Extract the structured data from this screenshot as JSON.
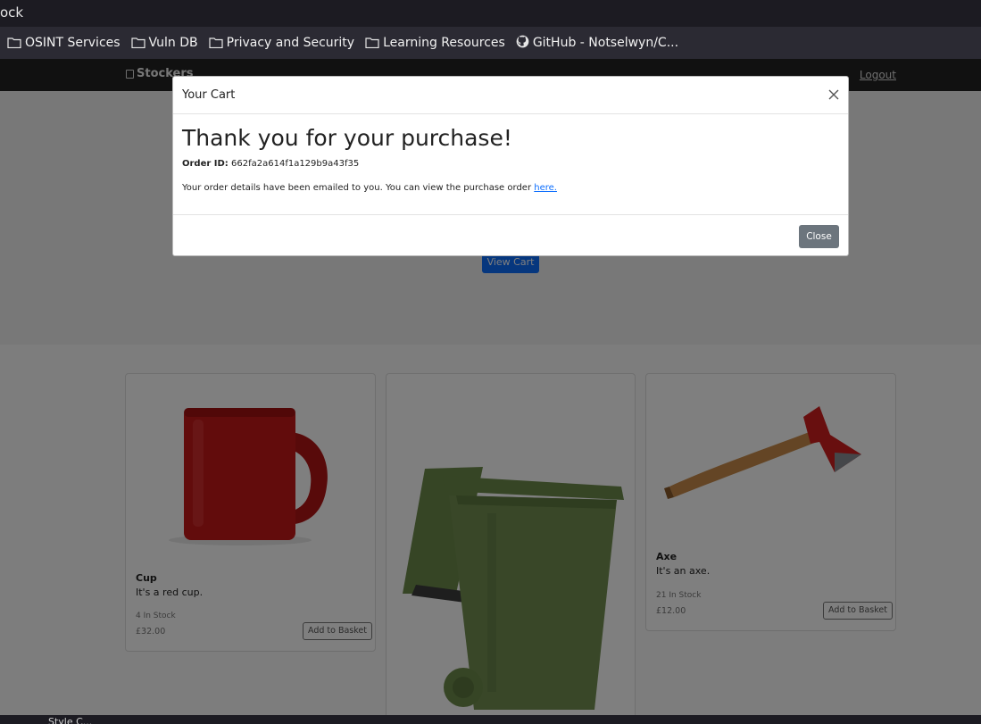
{
  "browser": {
    "title_fragment": "ock",
    "bookmarks": [
      {
        "label": "OSINT Services",
        "icon": "folder-icon"
      },
      {
        "label": "Vuln DB",
        "icon": "folder-icon"
      },
      {
        "label": "Privacy and Security",
        "icon": "folder-icon"
      },
      {
        "label": "Learning Resources",
        "icon": "folder-icon"
      },
      {
        "label": "GitHub - Notselwyn/C...",
        "icon": "github-icon"
      }
    ]
  },
  "site": {
    "brand": "Stockers",
    "logout": "Logout",
    "view_cart": "View Cart"
  },
  "products": [
    {
      "name": "Cup",
      "description": "It's a red cup.",
      "stock": "4 In Stock",
      "price": "£32.00",
      "button": "Add to Basket"
    },
    {
      "name": "",
      "description": "",
      "stock": "",
      "price": "",
      "button": ""
    },
    {
      "name": "Axe",
      "description": "It's an axe.",
      "stock": "21 In Stock",
      "price": "£12.00",
      "button": "Add to Basket"
    }
  ],
  "modal": {
    "title": "Your Cart",
    "heading": "Thank you for your purchase!",
    "order_label": "Order ID:",
    "order_id": "662fa2a614f1a129b9a43f35",
    "email_text": "Your order details have been emailed to you. You can view the purchase order",
    "link_text": "here.",
    "close_button": "Close"
  },
  "status_bar": {
    "text": "Style C..."
  },
  "colors": {
    "primary": "#0d6efd",
    "secondary": "#6c757d",
    "navbar": "#222222",
    "bookmarks_bg": "#2b2a33"
  }
}
